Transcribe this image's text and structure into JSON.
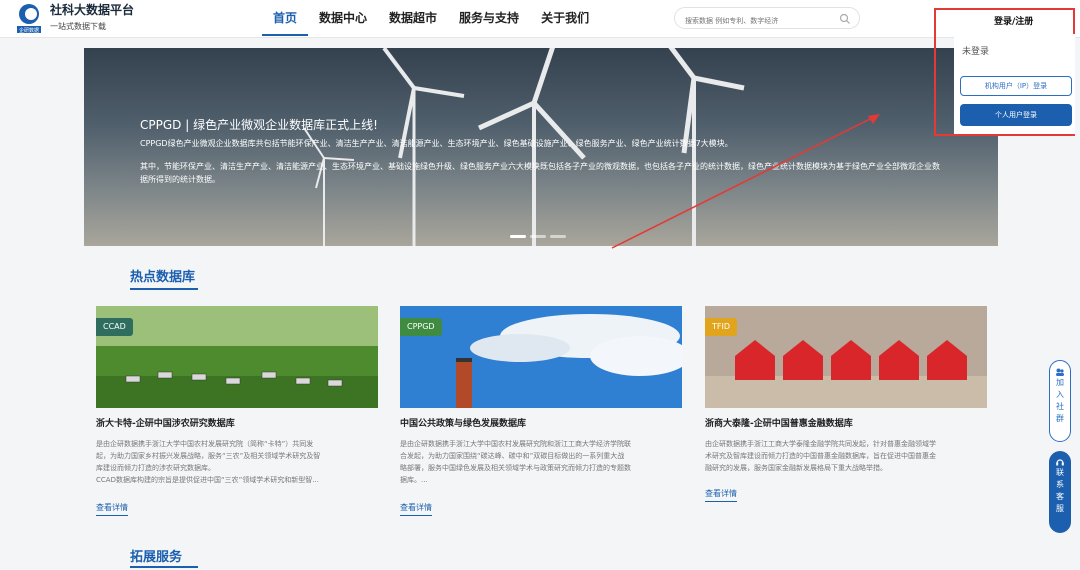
{
  "brand": {
    "name": "社科大数据平台",
    "sub": "一站式数据下载",
    "logo_text": "企研数据"
  },
  "nav": [
    {
      "label": "首页",
      "active": true
    },
    {
      "label": "数据中心"
    },
    {
      "label": "数据超市"
    },
    {
      "label": "服务与支持"
    },
    {
      "label": "关于我们"
    }
  ],
  "search": {
    "placeholder": "搜索数据 例如专利、数字经济"
  },
  "login": {
    "label": "登录/注册",
    "status": "未登录",
    "institution_button": "机构用户（IP）登录",
    "personal_button": "个人用户登录"
  },
  "banner": {
    "title": "CPPGD | 绿色产业微观企业数据库正式上线!",
    "p1": "CPPGD绿色产业微观企业数据库共包括节能环保产业、清洁生产产业、清洁能源产业、生态环境产业、绿色基础设施产业、绿色服务产业、绿色产业统计数据7大模块。",
    "p2": "其中，节能环保产业、清洁生产产业、清洁能源产业、生态环境产业、基础设施绿色升级、绿色服务产业六大模块既包括各子产业的微观数据，也包括各子产业的统计数据，绿色产业统计数据模块为基于绿色产业全部微观企业数据所得到的统计数据。"
  },
  "hot": {
    "title": "热点数据库"
  },
  "ext": {
    "title": "拓展服务"
  },
  "cards": [
    {
      "tag": "CCAD",
      "tag_color": "#2f6d5e",
      "title": "浙大卡特-企研中国涉农研究数据库",
      "desc": "是由企研数据携手浙江大学中国农村发展研究院（简称“卡特”）共同发\n起，为助力国家乡村振兴发展战略，服务“三农”及相关领域学术研究及智\n库建设而倾力打造的涉农研究数据库。\nCCAD数据库构建的宗旨是提供促进中国“三农”领域学术研究和新型智...",
      "link": "查看详情"
    },
    {
      "tag": "CPPGD",
      "tag_color": "#3f8b42",
      "title": "中国公共政策与绿色发展数据库",
      "desc": "是由企研数据携手浙江大学中国农村发展研究院和浙江工商大学经济学院联\n合发起，为助力国家围绕“碳达峰、碳中和”双碳目标做出的一系列重大战\n略部署，服务中国绿色发展及相关领域学术与政策研究而倾力打造的专题数\n据库。...",
      "link": "查看详情"
    },
    {
      "tag": "TFID",
      "tag_color": "#e0a51c",
      "title": "浙商大泰隆-企研中国普惠金融数据库",
      "desc": "由企研数据携手浙江工商大学泰隆金融学院共同发起，针对普惠金融领域学\n术研究及智库建设而倾力打造的中国普惠金融数据库，旨在促进中国普惠金\n融研究的发展，服务国家金融新发展格局下重大战略举措。",
      "link": "查看详情"
    }
  ],
  "side": {
    "join": "加入社群",
    "contact": "联系客服"
  }
}
